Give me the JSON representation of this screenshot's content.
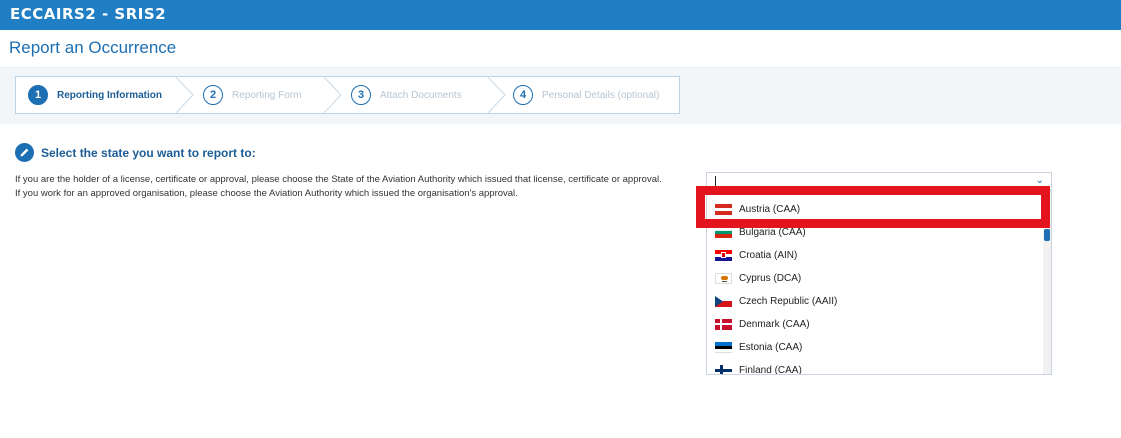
{
  "header": {
    "logo": "ECCAIRS2 - SRIS2"
  },
  "page": {
    "title": "Report an Occurrence"
  },
  "steps": [
    {
      "num": "1",
      "label": "Reporting Information",
      "active": true
    },
    {
      "num": "2",
      "label": "Reporting Form",
      "active": false
    },
    {
      "num": "3",
      "label": "Attach Documents",
      "active": false
    },
    {
      "num": "4",
      "label": "Personal Details (optional)",
      "active": false
    }
  ],
  "section": {
    "title": "Select the state you want to report to:",
    "line1": "If you are the holder of a license, certificate or approval, please choose the State of the Aviation Authority which issued that license, certificate or approval.",
    "line2": "If you work for an approved organisation, please choose the Aviation Authority which issued the organisation's approval."
  },
  "state_select": {
    "value": ""
  },
  "options": [
    {
      "label": "Austria (CAA)",
      "flag": "austria-flag-icon"
    },
    {
      "label": "Bulgaria (CAA)",
      "flag": "bulgaria-flag-icon"
    },
    {
      "label": "Croatia (AIN)",
      "flag": "croatia-flag-icon"
    },
    {
      "label": "Cyprus (DCA)",
      "flag": "cyprus-flag-icon"
    },
    {
      "label": "Czech Republic (AAII)",
      "flag": "czech-flag-icon"
    },
    {
      "label": "Denmark (CAA)",
      "flag": "denmark-flag-icon"
    },
    {
      "label": "Estonia (CAA)",
      "flag": "estonia-flag-icon"
    },
    {
      "label": "Finland (CAA)",
      "flag": "finland-flag-icon"
    }
  ],
  "colors": {
    "brand": "#1f7ec4",
    "highlight": "#e3141d"
  }
}
